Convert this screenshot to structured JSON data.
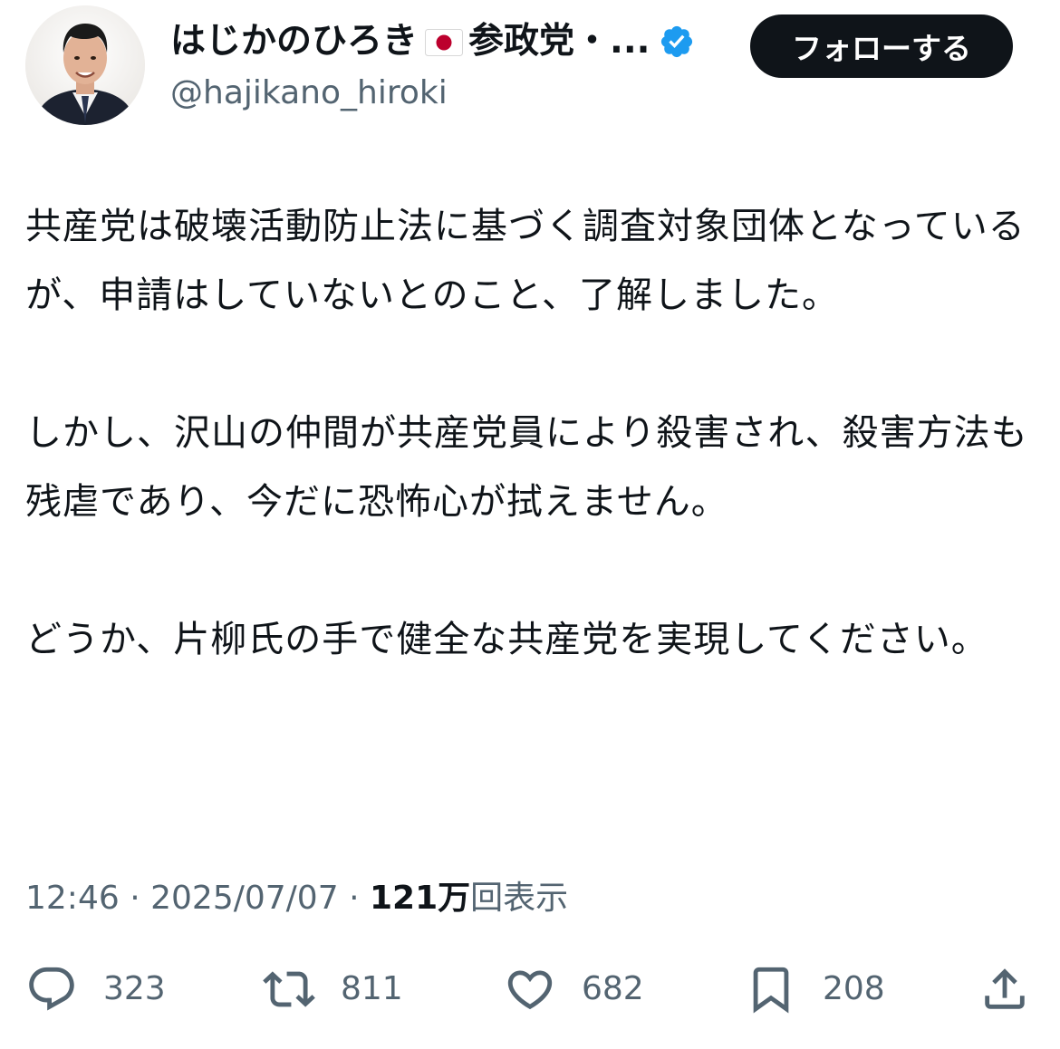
{
  "author": {
    "display_name": "はじかのひろき",
    "flag_icon": "japan-flag-icon",
    "name_suffix": "参政党・...",
    "verified_icon": "verified-badge-icon",
    "verified_color": "#1d9bf0",
    "handle": "@hajikano_hiroki"
  },
  "follow_button": {
    "label": "フォローする"
  },
  "tweet": {
    "paragraphs": [
      "共産党は破壊活動防止法に基づく調査対象団体となっているが、申請はしていないとのこと、了解しました。",
      "しかし、沢山の仲間が共産党員により殺害され、殺害方法も残虐であり、今だに恐怖心が拭えません。",
      "どうか、片柳氏の手で健全な共産党を実現してください。"
    ]
  },
  "meta": {
    "time": "12:46",
    "separator": "·",
    "date": "2025/07/07",
    "views_count": "121万",
    "views_label": "回表示"
  },
  "actions": {
    "reply": {
      "icon": "reply-icon",
      "count": "323"
    },
    "retweet": {
      "icon": "retweet-icon",
      "count": "811"
    },
    "like": {
      "icon": "heart-icon",
      "count": "682"
    },
    "bookmark": {
      "icon": "bookmark-icon",
      "count": "208"
    },
    "share": {
      "icon": "share-icon"
    }
  },
  "colors": {
    "text_primary": "#0f1419",
    "text_secondary": "#536471",
    "follow_button_bg": "#0f1419",
    "follow_button_text": "#ffffff"
  }
}
